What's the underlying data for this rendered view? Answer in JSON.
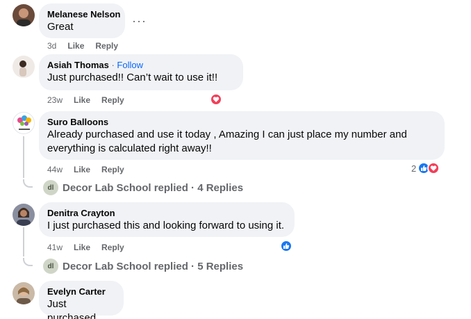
{
  "comments": [
    {
      "author": "Melanese Nelson",
      "text": "Great",
      "time": "3d",
      "like": "Like",
      "reply": "Reply",
      "more": "···"
    },
    {
      "author": "Asiah Thomas",
      "follow_sep": " · ",
      "follow": "Follow",
      "text": "Just purchased!! Can’t wait to use it!!",
      "time": "23w",
      "like": "Like",
      "reply": "Reply"
    },
    {
      "author": "Suro Balloons",
      "text": "Already purchased and use it today , Amazing I can just place my number and everything is calculated right away!!",
      "time": "44w",
      "like": "Like",
      "reply": "Reply",
      "reaction_count": "2",
      "replies": "Decor Lab School replied · 4 Replies"
    },
    {
      "author": "Denitra Crayton",
      "text": "I just purchased this and looking forward to using it.",
      "time": "41w",
      "like": "Like",
      "reply": "Reply",
      "replies": "Decor Lab School replied · 5 Replies"
    },
    {
      "author": "Evelyn Carter",
      "text": "Just purchased"
    }
  ],
  "reply_logo_text": "dl",
  "colors": {
    "love": "#f33e58",
    "like": "#1877f2",
    "link": "#0866ff",
    "bubble": "#f0f2f5"
  },
  "icons": [
    "heart-icon",
    "thumbs-up-icon",
    "more-options-icon"
  ]
}
